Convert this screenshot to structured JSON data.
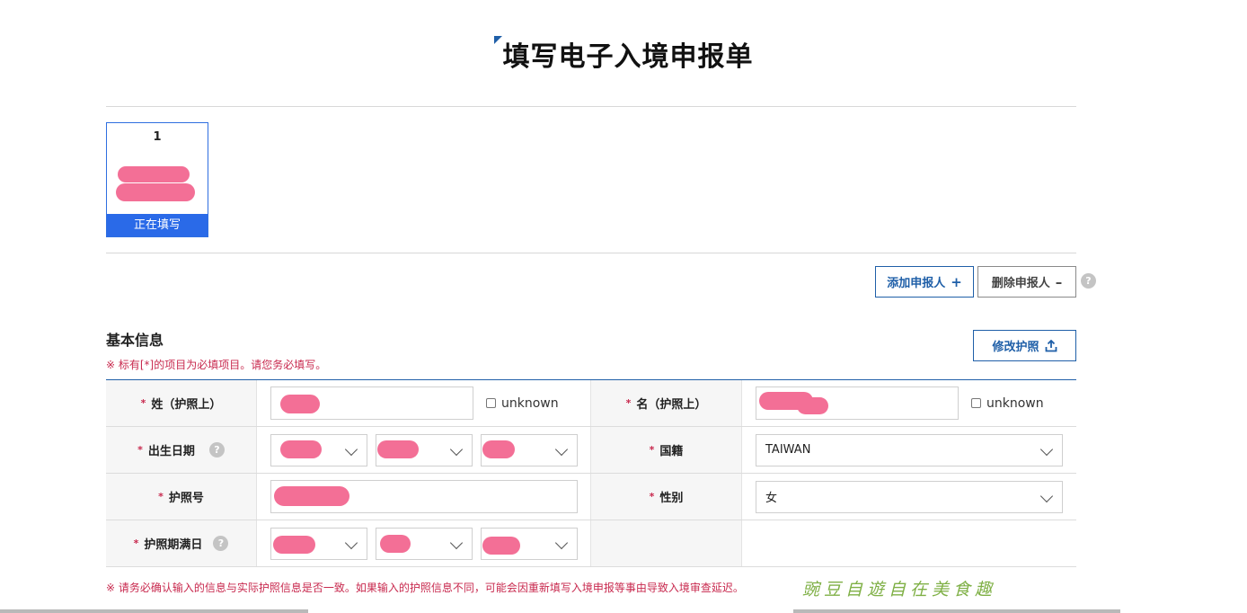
{
  "page": {
    "title": "填写电子入境申报单"
  },
  "applicant_card": {
    "number": "1",
    "status": "正在填写"
  },
  "actions": {
    "add_label": "添加申报人",
    "add_symbol": "+",
    "delete_label": "删除申报人",
    "delete_symbol": "–",
    "help": "?"
  },
  "section": {
    "title": "基本信息",
    "required_note": "※ 标有[*]的项目为必填项目。请您务必填写。",
    "edit_passport_label": "修改护照"
  },
  "form": {
    "required_mark": "*",
    "help": "?",
    "surname_label": "姓（护照上）",
    "given_name_label": "名（护照上）",
    "unknown_label": "unknown",
    "birth_date_label": "出生日期",
    "nationality_label": "国籍",
    "nationality_value": "TAIWAN",
    "passport_no_label": "护照号",
    "gender_label": "性别",
    "gender_value": "女",
    "passport_expiry_label": "护照期满日"
  },
  "footer_note": "※ 请务必确认输入的信息与实际护照信息是否一致。如果输入的护照信息不同，可能会因重新填写入境申报等事由导致入境审查延迟。",
  "watermark": "豌豆自遊自在美食趣",
  "colors": {
    "accent": "#1f5fa8",
    "active_blue": "#2a6ae8",
    "required_red": "#c8294e",
    "redaction": "#f36f96"
  }
}
